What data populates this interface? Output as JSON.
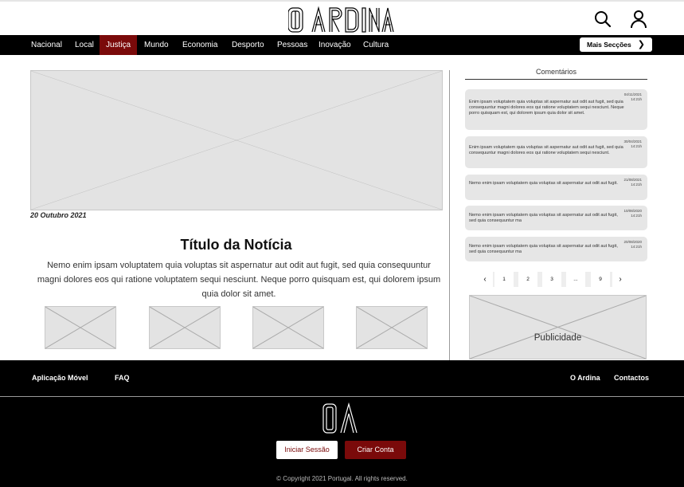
{
  "header": {
    "logo_text": "O ARDINA"
  },
  "nav": {
    "items": [
      {
        "label": "Nacional"
      },
      {
        "label": "Local"
      },
      {
        "label": "Justiça",
        "active": true
      },
      {
        "label": "Mundo"
      },
      {
        "label": "Economia"
      },
      {
        "label": "Desporto"
      },
      {
        "label": "Pessoas"
      },
      {
        "label": "Inovação"
      },
      {
        "label": "Cultura"
      }
    ],
    "more_label": "Mais Secções"
  },
  "article": {
    "date": "20 Outubro 2021",
    "title": "Título da Notícia",
    "body": "Nemo enim ipsam voluptatem quia voluptas sit aspernatur aut odit aut fugit, sed quia consequuntur magni dolores eos qui ratione voluptatem sequi nesciunt. Neque porro quisquam est, qui dolorem ipsum quia dolor sit amet."
  },
  "comments": {
    "title": "Comentários",
    "items": [
      {
        "date": "04/11/2021",
        "time": "14:21h",
        "text": "Enim ipsam voluptatem quia voluptas sit aspernatur aut odit aut fugit, sed quia consequuntur magni dolores eos qui ratione voluptatem sequi nesciunt. Neque porro quisquam est, qui dolorem ipsum quia dolor sit amet."
      },
      {
        "date": "30/04/2021",
        "time": "14:21h",
        "text": "Enim ipsam voluptatem quia voluptas sit aspernatur aut odit aut fugit, sed quia consequuntur magni dolores eos qui ratione voluptatem sequi nesciunt."
      },
      {
        "date": "21/08/2021",
        "time": "14:21h",
        "text": "Nemo enim ipsam voluptatem quia voluptas sit aspernatur aut odit aut fugit."
      },
      {
        "date": "10/08/2020",
        "time": "14:21h",
        "text": "Nemo enim ipsam voluptatem quia voluptas sit aspernatur aut odit aut fugit, sed quia consequuntur ma"
      },
      {
        "date": "20/08/2020",
        "time": "14:21h",
        "text": "Nemo enim ipsam voluptatem quia voluptas sit aspernatur aut odit aut fugit, sed quia consequuntur ma"
      }
    ],
    "pagination": {
      "prev": "‹",
      "pages": [
        "1",
        "2",
        "3",
        "...",
        "9"
      ],
      "next": "›"
    }
  },
  "ad": {
    "label": "Publicidade"
  },
  "footer": {
    "links_left": [
      "Aplicação Móvel",
      "FAQ"
    ],
    "links_right": [
      "O Ardina",
      "Contactos"
    ],
    "login_label": "Iniciar Sessão",
    "signup_label": "Criar Conta",
    "copyright": "© Copyright 2021 Portugal. All rights reserved."
  },
  "colors": {
    "accent": "#7a0a0a",
    "nav_bg": "#000000",
    "placeholder": "#e3e3e3"
  }
}
